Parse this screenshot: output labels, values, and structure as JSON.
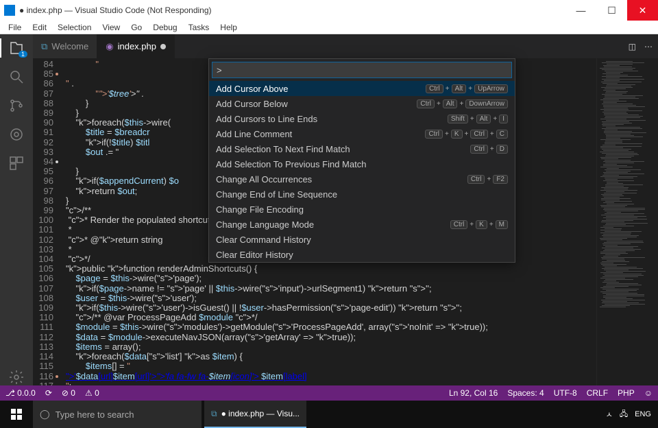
{
  "window": {
    "title": "● index.php — Visual Studio Code (Not Responding)"
  },
  "menu": [
    "File",
    "Edit",
    "Selection",
    "View",
    "Go",
    "Debug",
    "Tasks",
    "Help"
  ],
  "tabs": {
    "welcome": "Welcome",
    "file": "index.php"
  },
  "gutterStart": 84,
  "code": [
    "            \"<li><a &nbsp;</a></li>\" .",
    "            \"<i class                                                   e='$tree'>\" .",
    "        }",
    "    }",
    "",
    "    foreach($this->wire(",
    "        $title = $breadcr",
    "        if(!$title) $titl",
    "        $out .= \"<li><a h",
    "    }",
    "",
    "    if($appendCurrent) $o",
    "",
    "    return $out;",
    "}",
    "",
    "/**",
    " * Render the populated shortcuts head button or blank when not applicable",
    " *",
    " * @return string",
    " *",
    " */",
    "public function renderAdminShortcuts() {",
    "",
    "    $page = $this->wire('page');",
    "    if($page->name != 'page' || $this->wire('input')->urlSegment1) return '';",
    "    $user = $this->wire('user');",
    "    if($this->wire('user')->isGuest() || !$user->hasPermission('page-edit')) return '';",
    "    /** @var ProcessPageAdd $module */",
    "    $module = $this->wire('modules')->getModule('ProcessPageAdd', array('noInit' => true));",
    "    $data = $module->executeNavJSON(array('getArray' => true));",
    "    $items = array();",
    "",
    "    foreach($data['list'] as $item) {",
    "        $items[] = \"<li><a href='$data[url]$item[url]'><i class='fa fa-fw fa-$item[icon]'></i>&nbsp;$item[label]</a></li>\";"
  ],
  "palette": {
    "prefix": ">",
    "items": [
      {
        "label": "Add Cursor Above",
        "keys": [
          "Ctrl",
          "Alt",
          "UpArrow"
        ],
        "sel": true
      },
      {
        "label": "Add Cursor Below",
        "keys": [
          "Ctrl",
          "Alt",
          "DownArrow"
        ]
      },
      {
        "label": "Add Cursors to Line Ends",
        "keys": [
          "Shift",
          "Alt",
          "I"
        ]
      },
      {
        "label": "Add Line Comment",
        "keys": [
          "Ctrl",
          "K",
          "Ctrl",
          "C"
        ]
      },
      {
        "label": "Add Selection To Next Find Match",
        "keys": [
          "Ctrl",
          "D"
        ]
      },
      {
        "label": "Add Selection To Previous Find Match",
        "keys": []
      },
      {
        "label": "Change All Occurrences",
        "keys": [
          "Ctrl",
          "F2"
        ]
      },
      {
        "label": "Change End of Line Sequence",
        "keys": []
      },
      {
        "label": "Change File Encoding",
        "keys": []
      },
      {
        "label": "Change Language Mode",
        "keys": [
          "Ctrl",
          "K",
          "M"
        ]
      },
      {
        "label": "Clear Command History",
        "keys": []
      },
      {
        "label": "Clear Editor History",
        "keys": []
      }
    ]
  },
  "status": {
    "branch": "⎇ 0.0.0",
    "sync": "⟳",
    "err": "⊘ 0",
    "warn": "⚠ 0",
    "pos": "Ln 92, Col 16",
    "spaces": "Spaces: 4",
    "enc": "UTF-8",
    "eol": "CRLF",
    "lang": "PHP",
    "smile": "☺"
  },
  "taskbar": {
    "search": "Type here to search",
    "task": "● index.php — Visu...",
    "up": "ㅅ",
    "net": "🖧",
    "lang": "ENG"
  }
}
